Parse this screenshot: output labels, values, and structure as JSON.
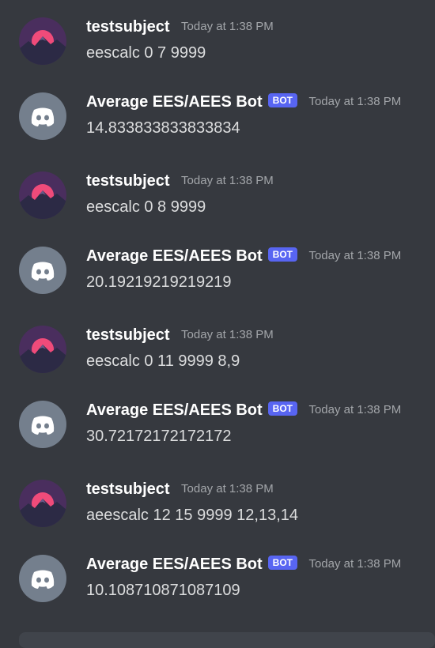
{
  "colors": {
    "background": "#36393f",
    "username": "#ffffff",
    "message_text": "#dcddde",
    "timestamp": "#a3a6aa",
    "bot_tag": "#5865f2",
    "bot_avatar": "#747f8d",
    "user_avatar_sky": "#4a2e5e",
    "user_avatar_sun": "#f04b7a",
    "user_avatar_mountains": "#2c2a45"
  },
  "messages": [
    {
      "author": "testsubject",
      "is_bot": false,
      "avatar_icon": "mountain-sunset-avatar",
      "timestamp": "Today at 1:38 PM",
      "content": "eescalc 0 7 9999"
    },
    {
      "author": "Average EES/AEES Bot",
      "is_bot": true,
      "bot_tag": "BOT",
      "avatar_icon": "discord-logo-icon",
      "timestamp": "Today at 1:38 PM",
      "content": "14.833833833833834"
    },
    {
      "author": "testsubject",
      "is_bot": false,
      "avatar_icon": "mountain-sunset-avatar",
      "timestamp": "Today at 1:38 PM",
      "content": "eescalc 0 8 9999"
    },
    {
      "author": "Average EES/AEES Bot",
      "is_bot": true,
      "bot_tag": "BOT",
      "avatar_icon": "discord-logo-icon",
      "timestamp": "Today at 1:38 PM",
      "content": "20.19219219219219"
    },
    {
      "author": "testsubject",
      "is_bot": false,
      "avatar_icon": "mountain-sunset-avatar",
      "timestamp": "Today at 1:38 PM",
      "content": "eescalc 0 11 9999 8,9"
    },
    {
      "author": "Average EES/AEES Bot",
      "is_bot": true,
      "bot_tag": "BOT",
      "avatar_icon": "discord-logo-icon",
      "timestamp": "Today at 1:38 PM",
      "content": "30.72172172172172"
    },
    {
      "author": "testsubject",
      "is_bot": false,
      "avatar_icon": "mountain-sunset-avatar",
      "timestamp": "Today at 1:38 PM",
      "content": "aeescalc 12 15 9999 12,13,14"
    },
    {
      "author": "Average EES/AEES Bot",
      "is_bot": true,
      "bot_tag": "BOT",
      "avatar_icon": "discord-logo-icon",
      "timestamp": "Today at 1:38 PM",
      "content": "10.108710871087109"
    }
  ]
}
